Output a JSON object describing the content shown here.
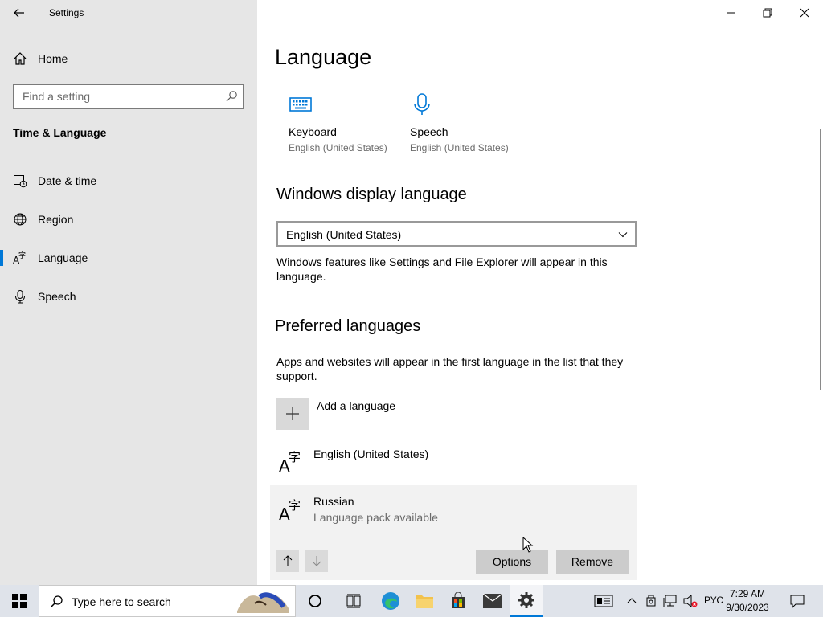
{
  "window": {
    "app_title": "Settings"
  },
  "sidebar": {
    "home_label": "Home",
    "search_placeholder": "Find a setting",
    "section_title": "Time & Language",
    "items": [
      {
        "label": "Date & time",
        "icon": "calendar-clock-icon"
      },
      {
        "label": "Region",
        "icon": "globe-icon"
      },
      {
        "label": "Language",
        "icon": "language-icon",
        "active": true
      },
      {
        "label": "Speech",
        "icon": "microphone-icon"
      }
    ]
  },
  "main": {
    "title": "Language",
    "quick_links": [
      {
        "title": "Keyboard",
        "subtitle": "English (United States)",
        "icon": "keyboard-icon"
      },
      {
        "title": "Speech",
        "subtitle": "English (United States)",
        "icon": "microphone-icon"
      }
    ],
    "display_language": {
      "heading": "Windows display language",
      "selected": "English (United States)",
      "description": "Windows features like Settings and File Explorer will appear in this language."
    },
    "preferred": {
      "heading": "Preferred languages",
      "description": "Apps and websites will appear in the first language in the list that they support.",
      "add_label": "Add a language",
      "languages": [
        {
          "name": "English (United States)",
          "status": ""
        },
        {
          "name": "Russian",
          "status": "Language pack available"
        }
      ],
      "options_label": "Options",
      "remove_label": "Remove"
    }
  },
  "taskbar": {
    "search_placeholder": "Type here to search",
    "input_language": "РУС",
    "time": "7:29 AM",
    "date": "9/30/2023"
  },
  "colors": {
    "accent": "#0078d7",
    "sidebar_bg": "#e6e6e6",
    "taskbar_bg": "#dfe3ea"
  }
}
